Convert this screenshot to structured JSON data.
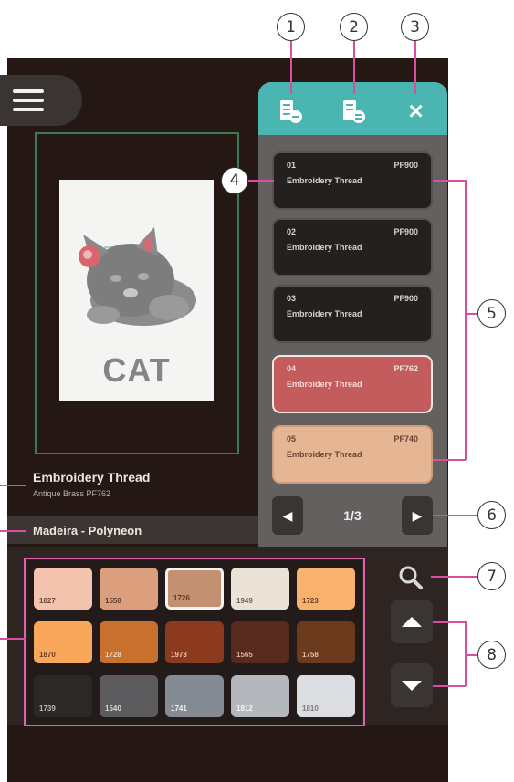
{
  "callouts": {
    "c1": "1",
    "c2": "2",
    "c3": "3",
    "c4": "4",
    "c5": "5",
    "c6": "6",
    "c7": "7",
    "c8": "8"
  },
  "design": {
    "label": "CAT"
  },
  "thread_info": {
    "title": "Embroidery Thread",
    "subtitle": "Antique Brass PF762"
  },
  "brand": "Madeira - Polyneon",
  "toolbar": {
    "icon1": "thread-list-icon",
    "icon2": "thread-swap-icon",
    "close": "×"
  },
  "thread_cards": [
    {
      "index": "01",
      "code": "PF900",
      "name": "Embroidery Thread",
      "style": "dark"
    },
    {
      "index": "02",
      "code": "PF900",
      "name": "Embroidery Thread",
      "style": "dark"
    },
    {
      "index": "03",
      "code": "PF900",
      "name": "Embroidery Thread",
      "style": "dark"
    },
    {
      "index": "04",
      "code": "PF762",
      "name": "Embroidery Thread",
      "style": "red"
    },
    {
      "index": "05",
      "code": "PF740",
      "name": "Embroidery Thread",
      "style": "peach"
    }
  ],
  "pager": {
    "label": "1/3"
  },
  "swatches": [
    {
      "code": "1827",
      "color": "#f3c3ae",
      "text": "#6c4a3c"
    },
    {
      "code": "1558",
      "color": "#dc9f7e",
      "text": "#5e3c2e"
    },
    {
      "code": "1726",
      "color": "#c39071",
      "text": "#5c3c2c",
      "selected": true
    },
    {
      "code": "1949",
      "color": "#ece3d8",
      "text": "#6d6258"
    },
    {
      "code": "1723",
      "color": "#f8b26e",
      "text": "#6b4422"
    },
    {
      "code": "1870",
      "color": "#f9a75b",
      "text": "#6a3d18"
    },
    {
      "code": "1728",
      "color": "#c8702d",
      "text": "#f0d4ba"
    },
    {
      "code": "1973",
      "color": "#8c3a1d",
      "text": "#f2c8b2"
    },
    {
      "code": "1565",
      "color": "#582a1d",
      "text": "#d8b4a3"
    },
    {
      "code": "1758",
      "color": "#6c3a1c",
      "text": "#e3c1a4"
    },
    {
      "code": "1739",
      "color": "#2b2827",
      "text": "#bcb6b2"
    },
    {
      "code": "1540",
      "color": "#5c5c5f",
      "text": "#d7d7d9"
    },
    {
      "code": "1741",
      "color": "#848b93",
      "text": "#eef0f2"
    },
    {
      "code": "1812",
      "color": "#b4b8bd",
      "text": "#f4f5f6"
    },
    {
      "code": "1810",
      "color": "#dcdde0",
      "text": "#797b7f"
    }
  ]
}
